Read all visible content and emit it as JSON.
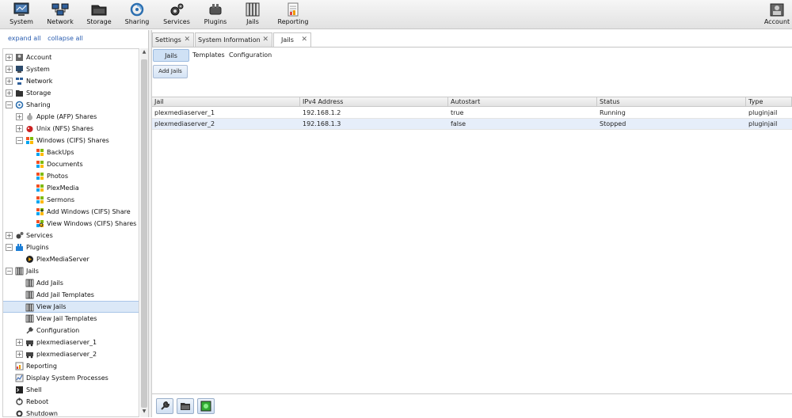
{
  "topbar": {
    "buttons": [
      {
        "label": "System",
        "icon": "system-icon"
      },
      {
        "label": "Network",
        "icon": "network-icon"
      },
      {
        "label": "Storage",
        "icon": "storage-icon"
      },
      {
        "label": "Sharing",
        "icon": "sharing-icon"
      },
      {
        "label": "Services",
        "icon": "services-icon"
      },
      {
        "label": "Plugins",
        "icon": "plugins-icon"
      },
      {
        "label": "Jails",
        "icon": "jails-icon"
      },
      {
        "label": "Reporting",
        "icon": "reporting-icon"
      }
    ],
    "account_label": "Account"
  },
  "sidebar": {
    "expand_all": "expand all",
    "collapse_all": "collapse all",
    "tree": [
      {
        "label": "Account",
        "expander": "+",
        "icon": "account-icon"
      },
      {
        "label": "System",
        "expander": "+",
        "icon": "system-icon"
      },
      {
        "label": "Network",
        "expander": "+",
        "icon": "network-icon"
      },
      {
        "label": "Storage",
        "expander": "+",
        "icon": "storage-icon"
      },
      {
        "label": "Sharing",
        "expander": "−",
        "icon": "sharing-icon"
      },
      {
        "label": "Apple (AFP) Shares",
        "expander": "+",
        "icon": "apple-icon"
      },
      {
        "label": "Unix (NFS) Shares",
        "expander": "+",
        "icon": "freebsd-icon"
      },
      {
        "label": "Windows (CIFS) Shares",
        "expander": "−",
        "icon": "windows-icon"
      },
      {
        "label": "BackUps",
        "expander": "",
        "icon": "windows-icon"
      },
      {
        "label": "Documents",
        "expander": "",
        "icon": "windows-icon"
      },
      {
        "label": "Photos",
        "expander": "",
        "icon": "windows-icon"
      },
      {
        "label": "PlexMedia",
        "expander": "",
        "icon": "windows-icon"
      },
      {
        "label": "Sermons",
        "expander": "",
        "icon": "windows-icon"
      },
      {
        "label": "Add Windows (CIFS) Share",
        "expander": "",
        "icon": "windows-add-icon"
      },
      {
        "label": "View Windows (CIFS) Shares",
        "expander": "",
        "icon": "windows-view-icon"
      },
      {
        "label": "Services",
        "expander": "+",
        "icon": "services-icon"
      },
      {
        "label": "Plugins",
        "expander": "−",
        "icon": "plugins-icon"
      },
      {
        "label": "PlexMediaServer",
        "expander": "",
        "icon": "plex-icon"
      },
      {
        "label": "Jails",
        "expander": "−",
        "icon": "jails-icon"
      },
      {
        "label": "Add Jails",
        "expander": "",
        "icon": "jails-icon"
      },
      {
        "label": "Add Jail Templates",
        "expander": "",
        "icon": "jails-icon"
      },
      {
        "label": "View Jails",
        "expander": "",
        "icon": "jails-icon",
        "selected": true
      },
      {
        "label": "View Jail Templates",
        "expander": "",
        "icon": "jails-icon"
      },
      {
        "label": "Configuration",
        "expander": "",
        "icon": "wrench-icon"
      },
      {
        "label": "plexmediaserver_1",
        "expander": "+",
        "icon": "jail-car-icon"
      },
      {
        "label": "plexmediaserver_2",
        "expander": "+",
        "icon": "jail-car-icon"
      },
      {
        "label": "Reporting",
        "expander": "",
        "icon": "reporting-icon"
      },
      {
        "label": "Display System Processes",
        "expander": "",
        "icon": "processes-icon"
      },
      {
        "label": "Shell",
        "expander": "",
        "icon": "shell-icon"
      },
      {
        "label": "Reboot",
        "expander": "",
        "icon": "reboot-icon"
      },
      {
        "label": "Shutdown",
        "expander": "",
        "icon": "shutdown-icon"
      }
    ]
  },
  "tabs": [
    {
      "label": "Settings",
      "active": false
    },
    {
      "label": "System Information",
      "active": false
    },
    {
      "label": "Jails",
      "active": true
    }
  ],
  "subtabs": [
    "Jails",
    "Templates",
    "Configuration"
  ],
  "add_jails_label": "Add Jails",
  "table": {
    "columns": [
      "Jail",
      "IPv4 Address",
      "Autostart",
      "Status",
      "Type"
    ],
    "rows": [
      [
        "plexmediaserver_1",
        "192.168.1.2",
        "true",
        "Running",
        "pluginjail"
      ],
      [
        "plexmediaserver_2",
        "192.168.1.3",
        "false",
        "Stopped",
        "pluginjail"
      ]
    ]
  },
  "bottom_buttons": [
    "wrench-icon",
    "folder-icon",
    "jail-start-icon"
  ],
  "colors": {
    "accent": "#dbe8f7",
    "link": "#2a5db0",
    "selected_row": "#e6eefa"
  }
}
